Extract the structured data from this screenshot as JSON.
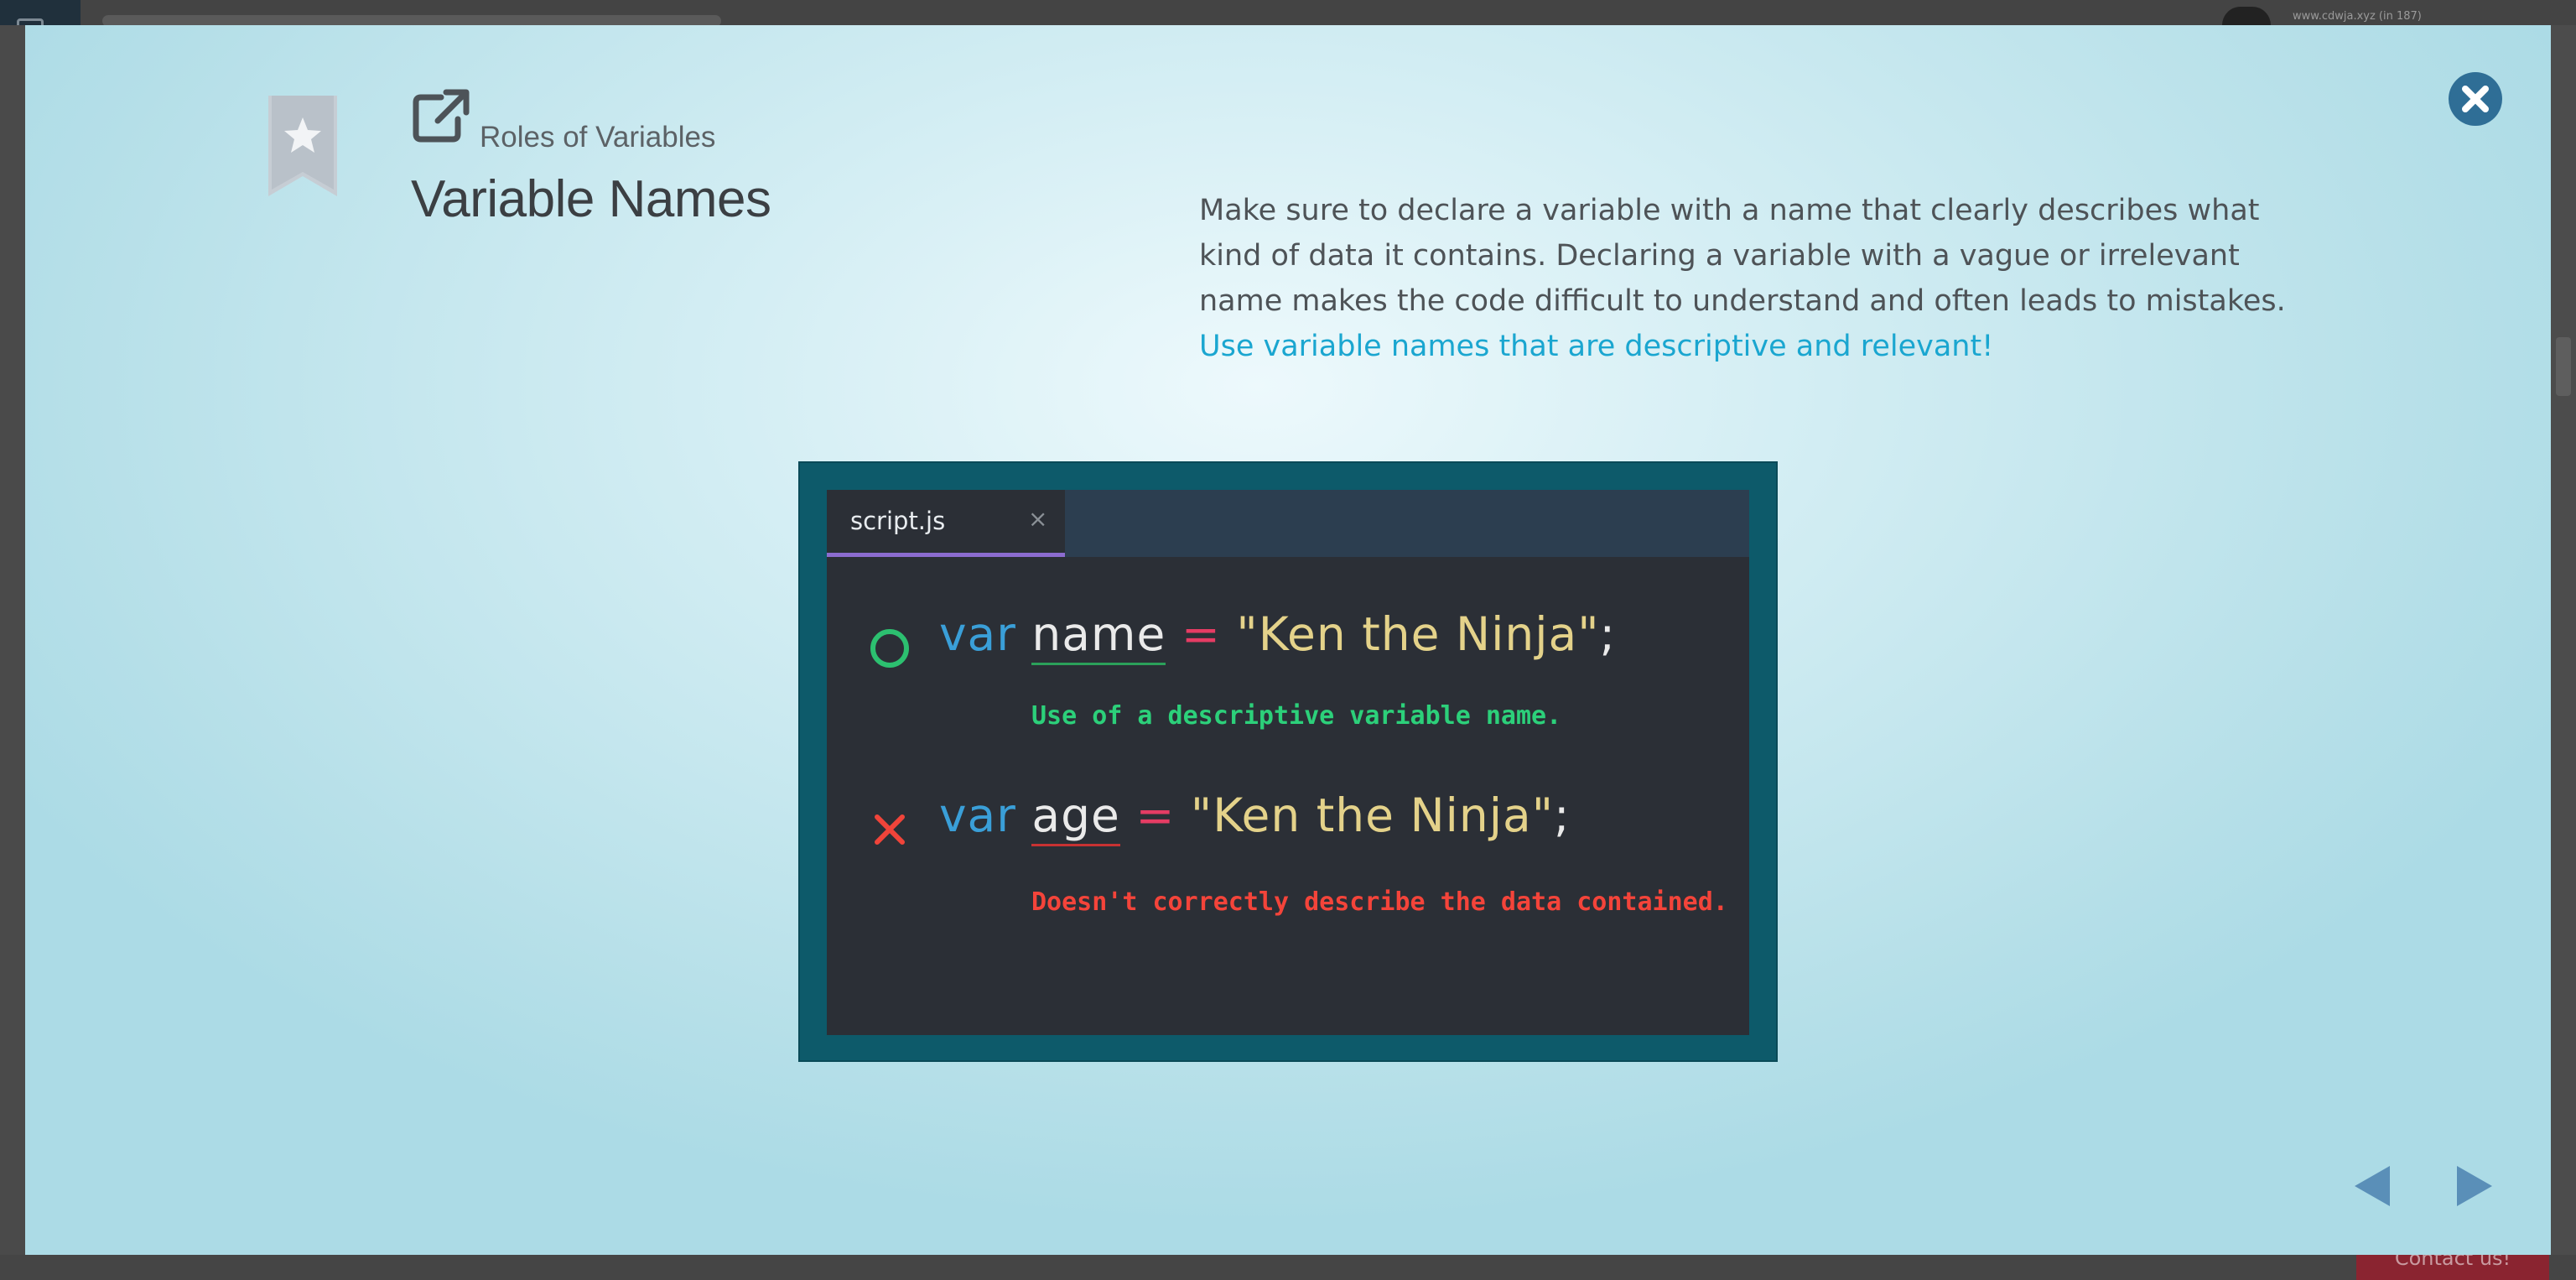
{
  "background": {
    "url_text": "www.cdwja.xyz (in 187)",
    "contact_label": "Contact us!"
  },
  "modal": {
    "category": "Roles of Variables",
    "title": "Variable Names",
    "description": "Make sure to declare a variable with a name that clearly describes what kind of data it contains. Declaring a variable with a vague or irrelevant name makes the code difficult to understand and often leads to mistakes. ",
    "description_highlight": "Use variable names that are descriptive and relevant!",
    "icons": {
      "bookmark": "bookmark-star-icon",
      "open": "external-link-icon",
      "close": "close-icon",
      "prev": "arrow-left-icon",
      "next": "arrow-right-icon"
    },
    "colors": {
      "highlight": "#1aa6d0",
      "close_button": "#2f6e96",
      "nav_arrows": "#5a8fb8"
    }
  },
  "figure": {
    "tab_label": "script.js",
    "tab_close": "×",
    "lines": [
      {
        "keyword": "var",
        "identifier": "name",
        "operator": "=",
        "value": "\"Ken the Ninja\"",
        "terminator": ";",
        "note": "Use of a descriptive variable name.",
        "mark": "circle-icon",
        "status": "good"
      },
      {
        "keyword": "var",
        "identifier": "age",
        "operator": "=",
        "value": "\"Ken the Ninja\"",
        "terminator": ";",
        "note": "Doesn't correctly describe the data contained.",
        "mark": "cross-icon",
        "status": "bad"
      }
    ],
    "colors": {
      "frame": "#0d5a6a",
      "editor_bg": "#2b2f36",
      "keyword": "#3a9fd8",
      "operator": "#e53c64",
      "string": "#e4d28a",
      "good": "#2cd07a",
      "bad": "#f4443a"
    }
  }
}
